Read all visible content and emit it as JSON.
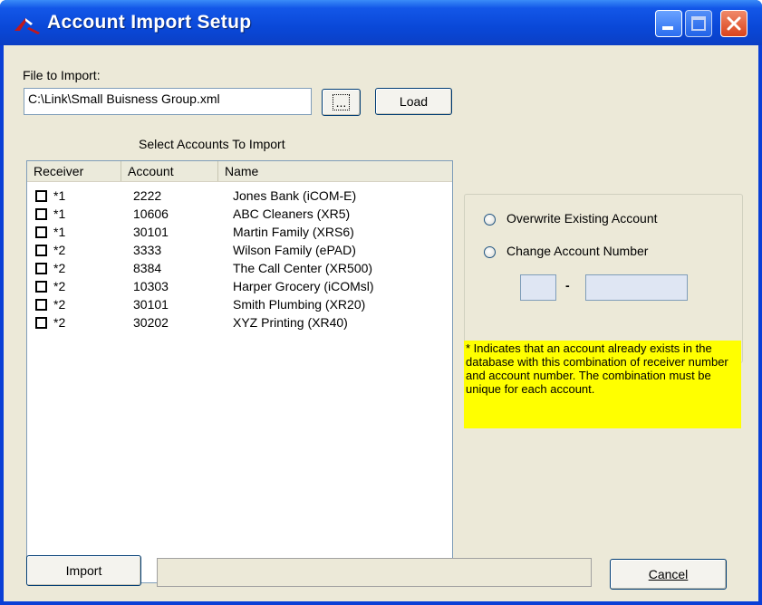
{
  "window": {
    "title": "Account Import Setup"
  },
  "file": {
    "label": "File to Import:",
    "path": "C:\\Link\\Small Buisness Group.xml",
    "browse_label": "...",
    "load_label": "Load"
  },
  "accounts": {
    "heading": "Select Accounts To Import",
    "columns": [
      "Receiver",
      "Account",
      "Name"
    ],
    "rows": [
      {
        "receiver": "*1",
        "account": "2222",
        "name": "Jones Bank (iCOM-E)"
      },
      {
        "receiver": "*1",
        "account": "10606",
        "name": "ABC Cleaners (XR5)"
      },
      {
        "receiver": "*1",
        "account": "30101",
        "name": "Martin Family (XRS6)"
      },
      {
        "receiver": "*2",
        "account": "3333",
        "name": "Wilson Family (ePAD)"
      },
      {
        "receiver": "*2",
        "account": "8384",
        "name": "The Call Center (XR500)"
      },
      {
        "receiver": "*2",
        "account": "10303",
        "name": "Harper Grocery (iCOMsl)"
      },
      {
        "receiver": "*2",
        "account": "30101",
        "name": "Smith Plumbing (XR20)"
      },
      {
        "receiver": "*2",
        "account": "30202",
        "name": "XYZ Printing (XR40)"
      }
    ]
  },
  "options": {
    "overwrite_label": "Overwrite Existing Account",
    "change_label": "Change Account Number",
    "separator": "-"
  },
  "note": "* Indicates that an account already exists in the database with this combination of receiver number and account number.  The combination must be unique for each account.",
  "footer": {
    "import_label": "Import",
    "cancel_label": "Cancel"
  },
  "colors": {
    "titlebar": "#0a48d8",
    "client": "#ece9d8",
    "note_bg": "#ffff00"
  }
}
